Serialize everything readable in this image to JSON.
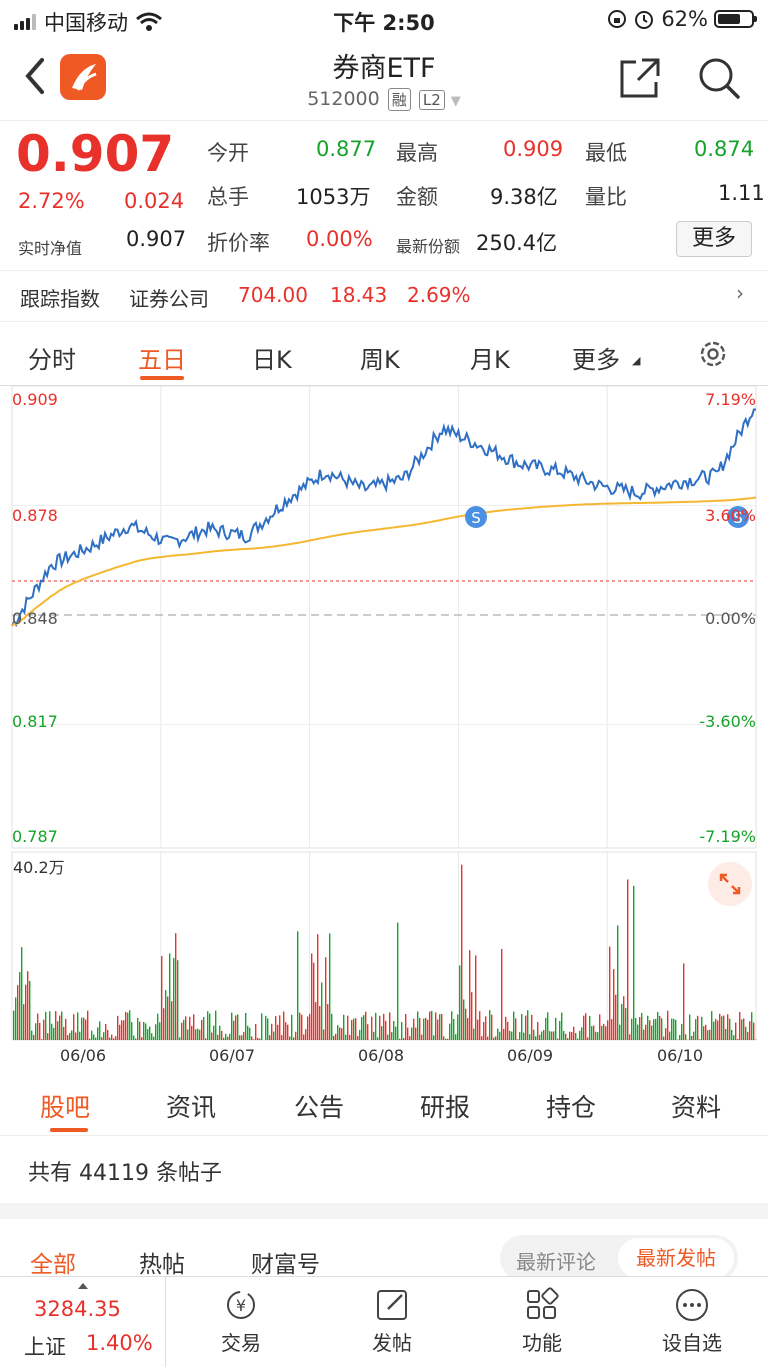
{
  "status": {
    "carrier": "中国移动",
    "time": "下午 2:50",
    "battery": "62%"
  },
  "header": {
    "title": "券商ETF",
    "code": "512000",
    "tag1": "融",
    "tag2": "L2"
  },
  "quote": {
    "price": "0.907",
    "pct": "2.72%",
    "change": "0.024",
    "nav_label": "实时净值",
    "nav_value": "0.907",
    "open_label": "今开",
    "open": "0.877",
    "high_label": "最高",
    "high": "0.909",
    "low_label": "最低",
    "low": "0.874",
    "volume_label": "总手",
    "volume": "1053万",
    "amount_label": "金额",
    "amount": "9.38亿",
    "ratio_label": "量比",
    "ratio": "1.11",
    "discount_label": "折价率",
    "discount": "0.00%",
    "share_label": "最新份额",
    "share": "250.4亿",
    "more": "更多"
  },
  "tracking": {
    "label": "跟踪指数",
    "index": "证券公司",
    "value": "704.00",
    "change": "18.43",
    "pct": "2.69%"
  },
  "chart_tabs": [
    "分时",
    "五日",
    "日K",
    "周K",
    "月K",
    "更多"
  ],
  "chart_data": {
    "type": "line",
    "x": [
      "06/06",
      "06/07",
      "06/08",
      "06/09",
      "06/10"
    ],
    "ylim": [
      0.787,
      0.909
    ],
    "y_left_ticks": [
      "0.909",
      "0.878",
      "0.848",
      "0.817",
      "0.787"
    ],
    "y_right_ticks": [
      "7.19%",
      "3.60%",
      "0.00%",
      "-3.60%",
      "-7.19%"
    ],
    "prev_close": 0.848,
    "volume_max_label": "40.2万",
    "series": [
      {
        "values": [
          0.845,
          0.862,
          0.867,
          0.873,
          0.868,
          0.872,
          0.87,
          0.88,
          0.888,
          0.883,
          0.886,
          0.9,
          0.895,
          0.89,
          0.888,
          0.884,
          0.882,
          0.885,
          0.887,
          0.907
        ]
      }
    ],
    "colors": {
      "price": "#2f6fc4",
      "avg": "#f5b731",
      "up": "#e8312a",
      "down": "#16a32a"
    }
  },
  "feed_tabs": [
    "股吧",
    "资讯",
    "公告",
    "研报",
    "持仓",
    "资料"
  ],
  "posts_count": "共有 44119 条帖子",
  "sub_tabs": [
    "全部",
    "热帖",
    "财富号"
  ],
  "sort": {
    "a": "最新评论",
    "b": "最新发帖"
  },
  "bottom": {
    "index_value": "3284.35",
    "index_name": "上证",
    "index_pct": "1.40%",
    "items": [
      "交易",
      "发帖",
      "功能",
      "设自选"
    ]
  }
}
